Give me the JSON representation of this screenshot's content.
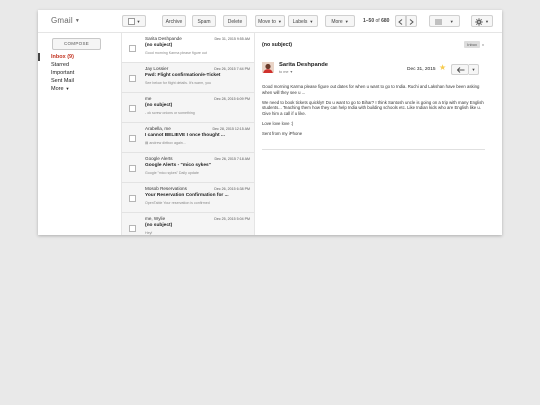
{
  "app": {
    "brand": "Gmail"
  },
  "toolbar": {
    "archive": "Archive",
    "spam": "Spam",
    "delete": "Delete",
    "move_to": "Move to",
    "labels": "Labels",
    "more": "More",
    "page_range": "1–50",
    "page_of": "of",
    "page_total": "680"
  },
  "sidebar": {
    "compose": "COMPOSE",
    "items": [
      {
        "label": "Inbox (9)"
      },
      {
        "label": "Starred"
      },
      {
        "label": "Important"
      },
      {
        "label": "Sent Mail"
      },
      {
        "label": "More"
      }
    ]
  },
  "messages": [
    {
      "sender": "Sarita Deshpande",
      "date": "Dec 31, 2015 9:55 AM",
      "subject": "(no subject)",
      "snippet": "Good morning Karma please figure out"
    },
    {
      "sender": "Jay Lossier",
      "date": "Dec 26, 2015 7:44 PM",
      "subject": "Fwd: Flight confirmation/e-Ticket",
      "snippet": "See below for flight details. It's warm, you"
    },
    {
      "sender": "me",
      "date": "Dec 28, 2015 6:09 PM",
      "subject": "(no subject)",
      "snippet": "- ok screw onions or something"
    },
    {
      "sender": "Arabella, me",
      "date": "Dec 28, 2015 12:15 AM",
      "subject": "I cannot BELIEVE I once thought ...",
      "snippet": "andrew dirtbox again..."
    },
    {
      "sender": "Google Alerts",
      "date": "Dec 26, 2015 7:18 AM",
      "subject": "Google Alerts - \"mico sykes\"",
      "snippet": "Google \"mico sykes\" Daily update"
    },
    {
      "sender": "Mosob Reservations",
      "date": "Dec 26, 2015 6:38 PM",
      "subject": "Your Reservation Confirmation for ...",
      "snippet": "OpenTable Your reservation is confirmed"
    },
    {
      "sender": "me, Wylie",
      "date": "Dec 25, 2015 5:04 PM",
      "subject": "(no subject)",
      "snippet": "Hey!"
    }
  ],
  "reader": {
    "subject": "(no subject)",
    "label": "Inbox",
    "label_close": "x",
    "from": "Sarita Deshpande",
    "to": "to me",
    "date": "Dec 31, 2015",
    "body": [
      "Good morning Karma please figure out dates for when u want to go to India. Ruchi and Lakshan have been asking when will they see u ...",
      "We need to book tickets quickly!! Do u want to go to Bihar? I think Santosh uncle is going on a trip with many English students... Teaching them how they can help India with building schools etc. Like Indian kids who are English like u. Give him a call if u like.",
      "Love love love :)",
      "Sent from my iPhone"
    ]
  },
  "colors": {
    "inbox_red": "#c23321",
    "star": "#f7cb4d",
    "avatar_red": "#d0312d"
  }
}
